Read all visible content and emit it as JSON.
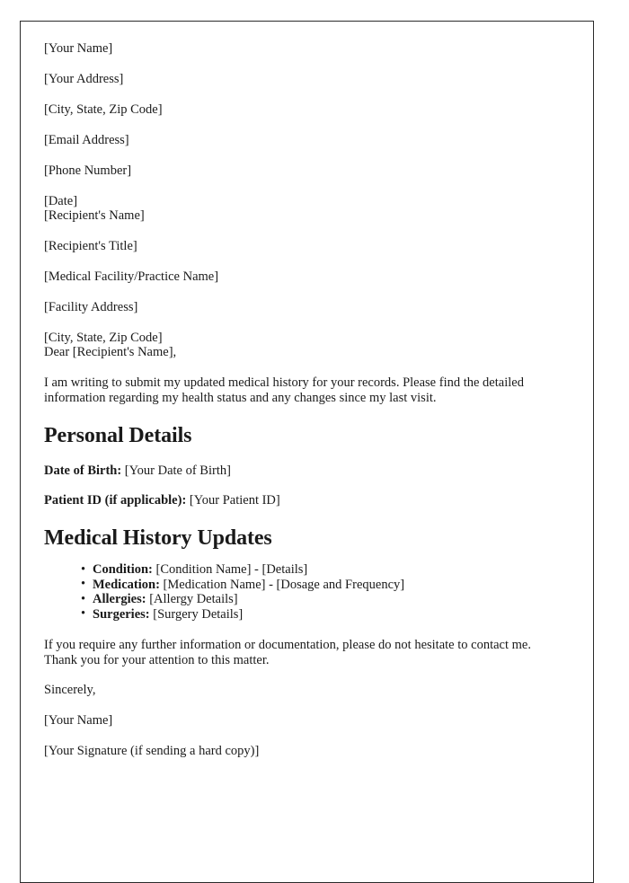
{
  "document": {
    "sender_block": [
      "[Your Name]",
      "[Your Address]",
      "[City, State, Zip Code]",
      "[Email Address]",
      "[Phone Number]",
      "[Date]"
    ],
    "recipient_block": [
      "[Recipient's Name]",
      "[Recipient's Title]",
      "[Medical Facility/Practice Name]",
      "[Facility Address]",
      "[City, State, Zip Code]"
    ],
    "salutation": "Dear [Recipient's Name],",
    "intro_paragraph": "I am writing to submit my updated medical history for your records. Please find the detailed information regarding my health status and any changes since my last visit.",
    "personal_details": {
      "heading": "Personal Details",
      "fields": [
        {
          "label": "Date of Birth:",
          "value": " [Your Date of Birth]"
        },
        {
          "label": "Patient ID (if applicable):",
          "value": " [Your Patient ID]"
        }
      ]
    },
    "medical_history": {
      "heading": "Medical History Updates",
      "items": [
        {
          "label": "Condition:",
          "value": " [Condition Name] - [Details]"
        },
        {
          "label": "Medication:",
          "value": " [Medication Name] - [Dosage and Frequency]"
        },
        {
          "label": "Allergies:",
          "value": " [Allergy Details]"
        },
        {
          "label": "Surgeries:",
          "value": " [Surgery Details]"
        }
      ]
    },
    "closing_paragraph": "If you require any further information or documentation, please do not hesitate to contact me. Thank you for your attention to this matter.",
    "sign_off": "Sincerely,",
    "signature_name": "[Your Name]",
    "signature_note": "[Your Signature (if sending a hard copy)]"
  },
  "colors": {
    "page_background": "#ffffff",
    "page_border": "#2b2b2b",
    "text": "#1a1a1a"
  }
}
